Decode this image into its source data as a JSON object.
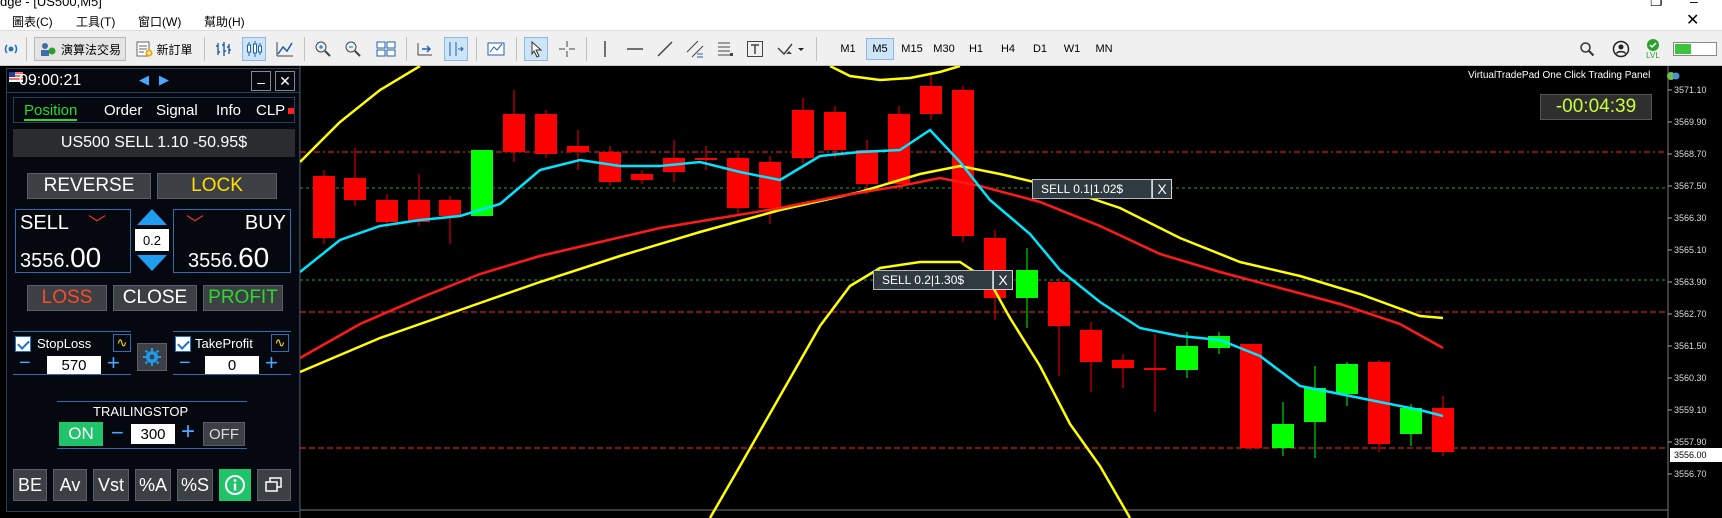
{
  "window": {
    "title": "dge - [US500,M5]",
    "controls": {
      "minimize": "–",
      "maximize": "❐"
    }
  },
  "menu": [
    "圖表(C)",
    "工具(T)",
    "窗口(W)",
    "幫助(H)"
  ],
  "toolbar": {
    "algo_trading": "演算法交易",
    "new_order": "新訂單",
    "timeframes": [
      "M1",
      "M5",
      "M15",
      "M30",
      "H1",
      "H4",
      "D1",
      "W1",
      "MN"
    ],
    "active_timeframe": "M5",
    "lvl_badge": "LVL"
  },
  "chart": {
    "symbol": "US500",
    "timeframe": "M5",
    "panel_caption": "VirtualTradePad One Click Trading Panel",
    "countdown": "-00:04:39",
    "price_scale": [
      "3571.10",
      "3569.90",
      "3568.70",
      "3567.50",
      "3566.30",
      "3565.10",
      "3563.90",
      "3562.70",
      "3561.50",
      "3560.30",
      "3559.10",
      "3557.90",
      "3556.70"
    ],
    "current_price_label": "3556.00",
    "order_labels": [
      {
        "text": "SELL 0.1|1.02$",
        "close": "X"
      },
      {
        "text": "SELL 0.2|1.30$",
        "close": "X"
      }
    ],
    "colors": {
      "bull": "#00ff00",
      "bear": "#ff0000",
      "ma_fast": "#00e5ff",
      "ma_slow": "#ff1a1a",
      "bands": "#ffff00"
    }
  },
  "panel": {
    "time": "09:00:21",
    "tabs": [
      "Position",
      "Order",
      "Signal",
      "Info",
      "CLP"
    ],
    "active_tab": "Position",
    "position_summary": "US500 SELL 1.10 -50.95$",
    "reverse_label": "REVERSE",
    "lock_label": "LOCK",
    "sell_label": "SELL",
    "buy_label": "BUY",
    "sell_price_main": "3556.",
    "sell_price_frac": "00",
    "buy_price_main": "3556.",
    "buy_price_frac": "60",
    "lot": "0.2",
    "loss_label": "LOSS",
    "close_label": "CLOSE",
    "profit_label": "PROFIT",
    "stoploss_label": "StopLoss",
    "stoploss_value": "570",
    "takeprofit_label": "TakeProfit",
    "takeprofit_value": "0",
    "trailing_label": "TRAILINGSTOP",
    "trailing_on": "ON",
    "trailing_value": "300",
    "trailing_off": "OFF",
    "bottom_buttons": [
      "BE",
      "Av",
      "Vst",
      "%A",
      "%S"
    ],
    "minus": "−",
    "plus": "+"
  }
}
